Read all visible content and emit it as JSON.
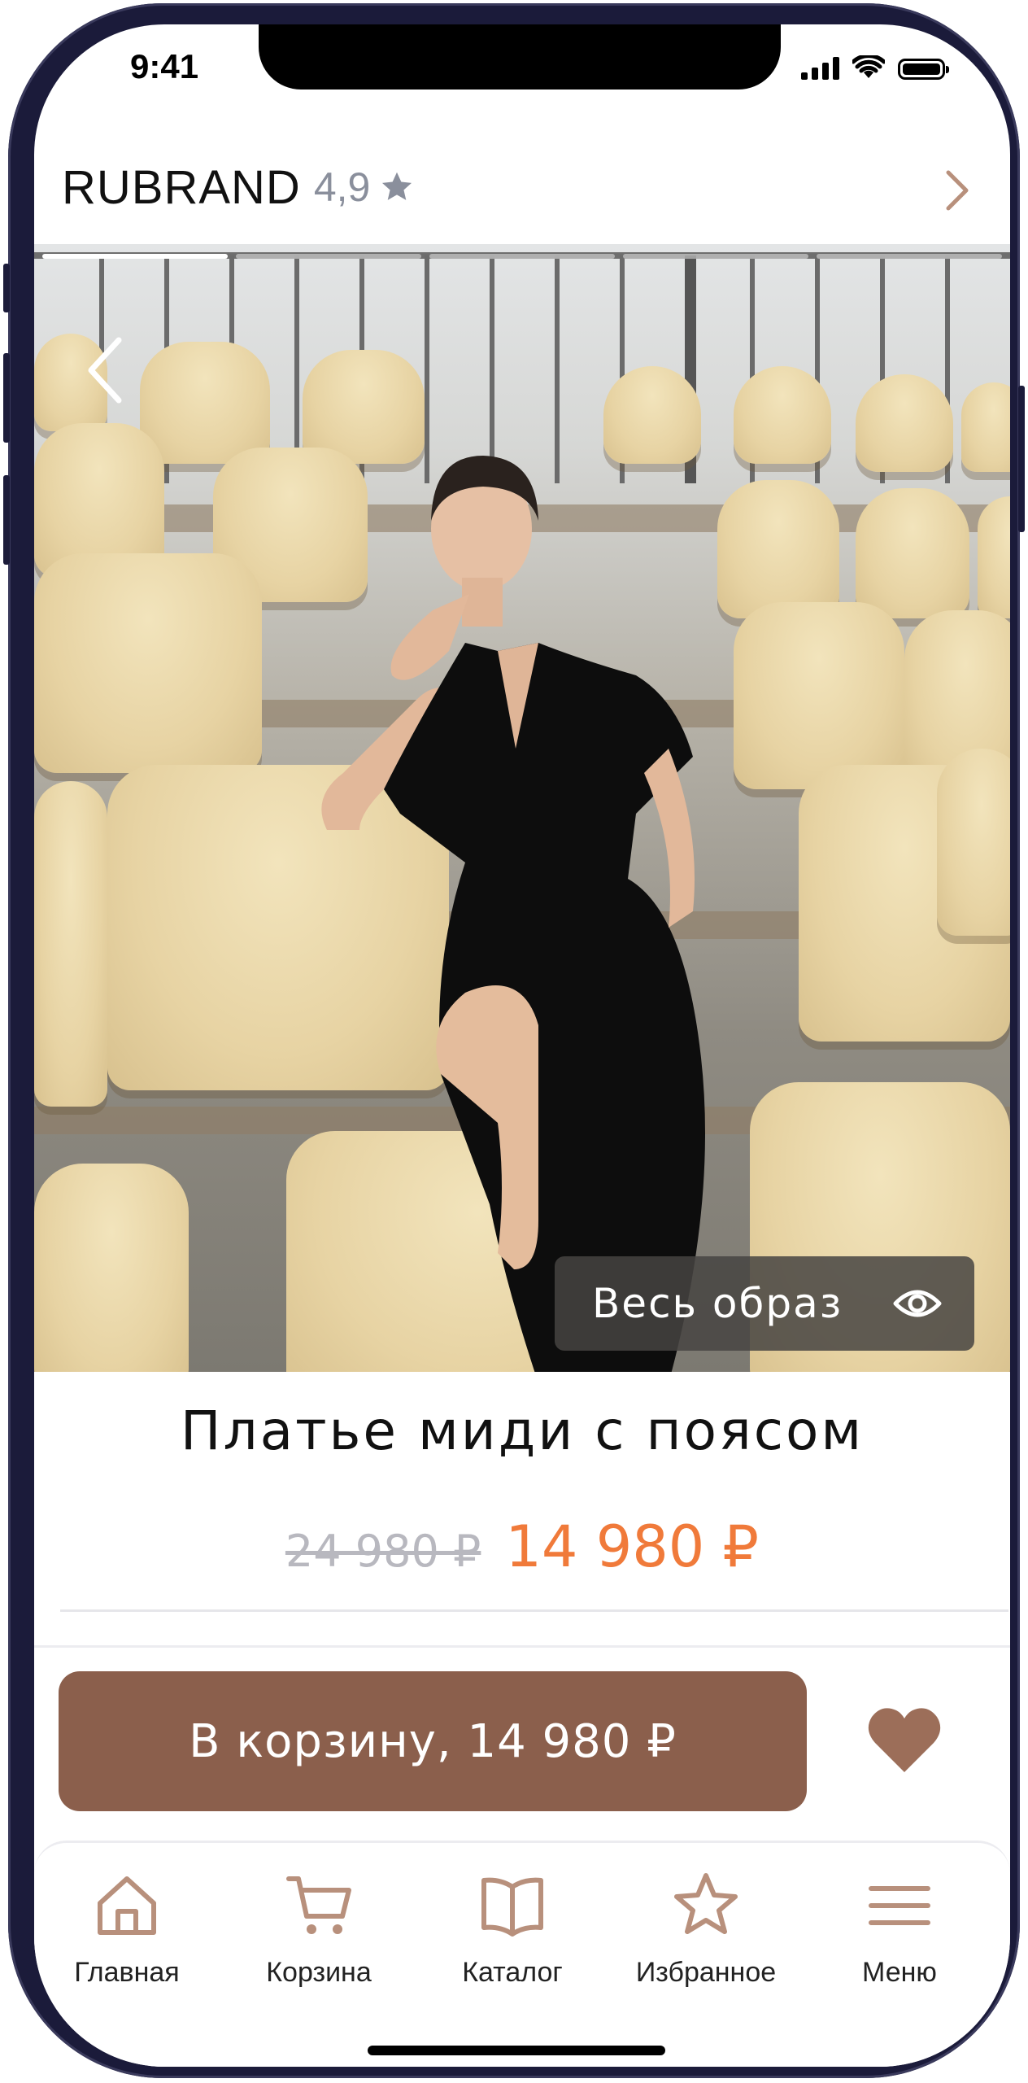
{
  "status_bar": {
    "time": "9:41"
  },
  "header": {
    "brand": "RUBRAND",
    "rating": "4,9",
    "rating_icon": "star-icon",
    "forward_icon": "chevron-right-icon"
  },
  "gallery": {
    "slide_count": 5,
    "active_slide": 1,
    "back_icon": "chevron-left-icon",
    "look_button_label": "Весь образ",
    "look_button_icon": "eye-icon"
  },
  "product": {
    "title": "Платье миди с поясом",
    "old_price": "24 980 ₽",
    "new_price": "14 980 ₽"
  },
  "actions": {
    "add_to_cart_label": "В корзину, 14 980 ₽",
    "favorite_icon": "heart-icon"
  },
  "tabbar": {
    "items": [
      {
        "label": "Главная",
        "icon": "home-icon"
      },
      {
        "label": "Корзина",
        "icon": "cart-icon"
      },
      {
        "label": "Каталог",
        "icon": "book-icon"
      },
      {
        "label": "Избранное",
        "icon": "star-outline-icon"
      },
      {
        "label": "Меню",
        "icon": "menu-icon"
      }
    ]
  },
  "colors": {
    "accent_brown": "#8b5f4c",
    "icon_brown": "#b8907c",
    "price_orange": "#f07a3a",
    "old_price_grey": "#b8b8bf"
  }
}
